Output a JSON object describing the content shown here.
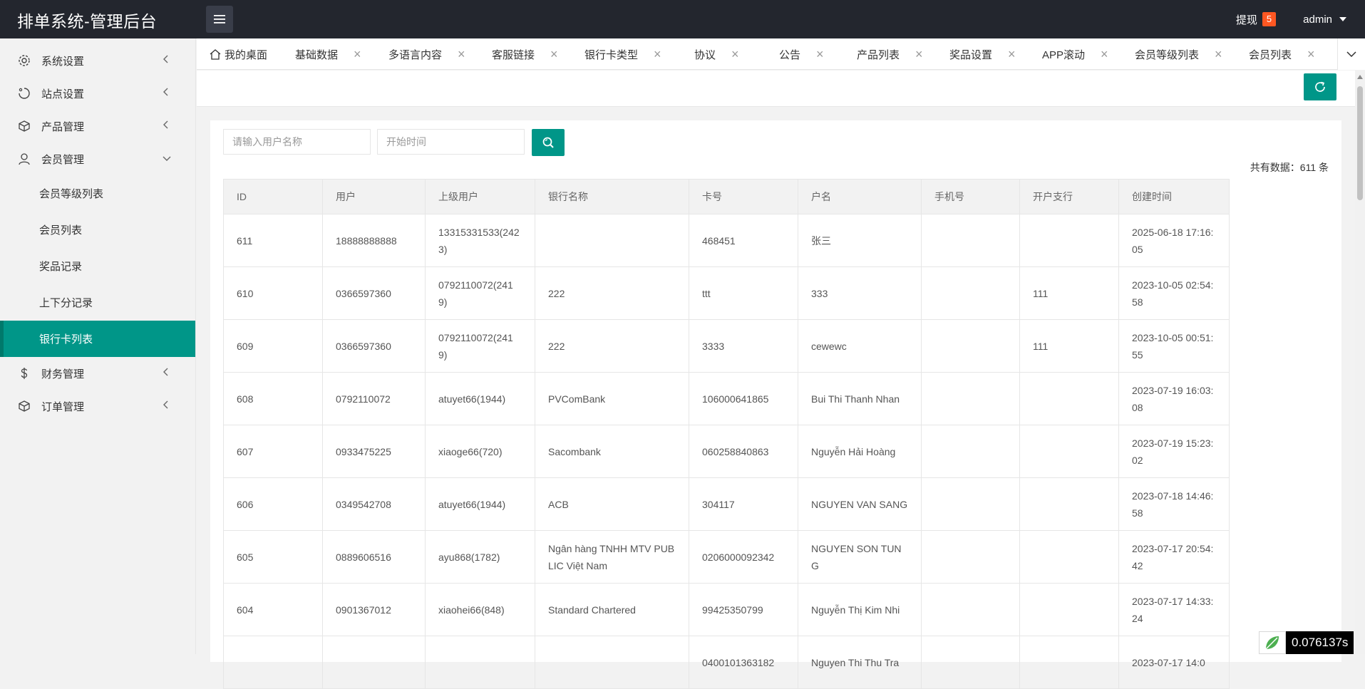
{
  "app": {
    "title": "排单系统-管理后台",
    "withdraw_label": "提现",
    "withdraw_count": "5",
    "user": "admin"
  },
  "sidebar": {
    "items": [
      {
        "label": "系统设置",
        "icon": "gear-icon"
      },
      {
        "label": "站点设置",
        "icon": "site-icon"
      },
      {
        "label": "产品管理",
        "icon": "box-icon"
      },
      {
        "label": "会员管理",
        "icon": "user-icon"
      }
    ],
    "sub_items": [
      "会员等级列表",
      "会员列表",
      "奖品记录",
      "上下分记录",
      "银行卡列表"
    ],
    "items_after": [
      {
        "label": "财务管理",
        "icon": "dollar-icon"
      },
      {
        "label": "订单管理",
        "icon": "box-icon"
      }
    ]
  },
  "tabs": [
    "我的桌面",
    "基础数据",
    "多语言内容",
    "客服链接",
    "银行卡类型",
    "协议",
    "公告",
    "产品列表",
    "奖品设置",
    "APP滚动",
    "会员等级列表",
    "会员列表"
  ],
  "search": {
    "username_placeholder": "请输入用户名称",
    "time_placeholder": "开始时间"
  },
  "total_text": "共有数据：611 条",
  "table": {
    "headers": [
      "ID",
      "用户",
      "上级用户",
      "银行名称",
      "卡号",
      "户名",
      "手机号",
      "开户支行",
      "创建时间"
    ],
    "rows": [
      [
        "611",
        "18888888888",
        "13315331533(2423)",
        "",
        "468451",
        "张三",
        "",
        "",
        "2025-06-18 17:16:05"
      ],
      [
        "610",
        "0366597360",
        "0792110072(2419)",
        "222",
        "ttt",
        "333",
        "",
        "111",
        "2023-10-05 02:54:58"
      ],
      [
        "609",
        "0366597360",
        "0792110072(2419)",
        "222",
        "3333",
        "cewewc",
        "",
        "111",
        "2023-10-05 00:51:55"
      ],
      [
        "608",
        "0792110072",
        "atuyet66(1944)",
        "PVComBank",
        "106000641865",
        "Bui Thi Thanh Nhan",
        "",
        "",
        "2023-07-19 16:03:08"
      ],
      [
        "607",
        "0933475225",
        "xiaoge66(720)",
        "Sacombank",
        "060258840863",
        "Nguyễn Hải Hoàng",
        "",
        "",
        "2023-07-19 15:23:02"
      ],
      [
        "606",
        "0349542708",
        "atuyet66(1944)",
        "ACB",
        "304117",
        "NGUYEN VAN SANG",
        "",
        "",
        "2023-07-18 14:46:58"
      ],
      [
        "605",
        "0889606516",
        "ayu868(1782)",
        "Ngân hàng TNHH MTV PUBLIC Việt Nam",
        "0206000092342",
        "NGUYEN SON TUNG",
        "",
        "",
        "2023-07-17 20:54:42"
      ],
      [
        "604",
        "0901367012",
        "xiaohei66(848)",
        "Standard Chartered",
        "99425350799",
        "Nguyễn Thị Kim Nhi",
        "",
        "",
        "2023-07-17 14:33:24"
      ],
      [
        "",
        "",
        "",
        "",
        "0400101363182",
        "Nguyen Thi Thu Tra",
        "",
        "",
        "2023-07-17 14:0"
      ]
    ]
  },
  "speed": "0.076137s",
  "colors": {
    "accent": "#009688",
    "topbar": "#23262e",
    "badge": "#ff5722"
  }
}
